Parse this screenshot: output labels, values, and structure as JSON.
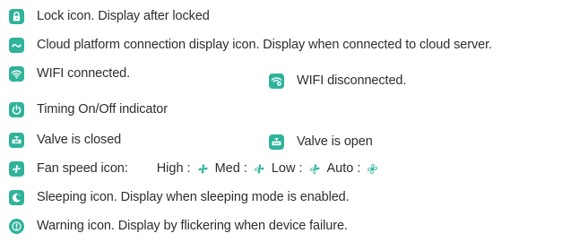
{
  "colors": {
    "accent": "#2fb39b",
    "text": "#2e2e2e",
    "background": "#ffffff"
  },
  "rows": {
    "lock": {
      "icon": "lock-icon",
      "text": "Lock icon. Display after locked"
    },
    "cloud": {
      "icon": "cloud-link-icon",
      "text": "Cloud platform connection display icon. Display when connected to cloud server."
    },
    "wifi": {
      "icon": "wifi-icon",
      "text": "WIFI connected.",
      "second_icon": "wifi-off-icon",
      "second_text": "WIFI disconnected."
    },
    "timer": {
      "icon": "power-icon",
      "text": "Timing On/Off indicator"
    },
    "valve": {
      "icon": "valve-closed-icon",
      "text": "Valve is closed",
      "second_icon": "valve-open-icon",
      "second_text": "Valve is open"
    },
    "fan": {
      "icon": "fan-icon",
      "text": "Fan speed icon:",
      "speeds": {
        "high": "High :",
        "med": "Med :",
        "low": "Low :",
        "auto": "Auto :"
      }
    },
    "sleep": {
      "icon": "moon-icon",
      "text": "Sleeping icon. Display when sleeping mode is enabled."
    },
    "warning": {
      "icon": "warning-icon",
      "text": "Warning icon. Display by flickering when device failure."
    }
  }
}
